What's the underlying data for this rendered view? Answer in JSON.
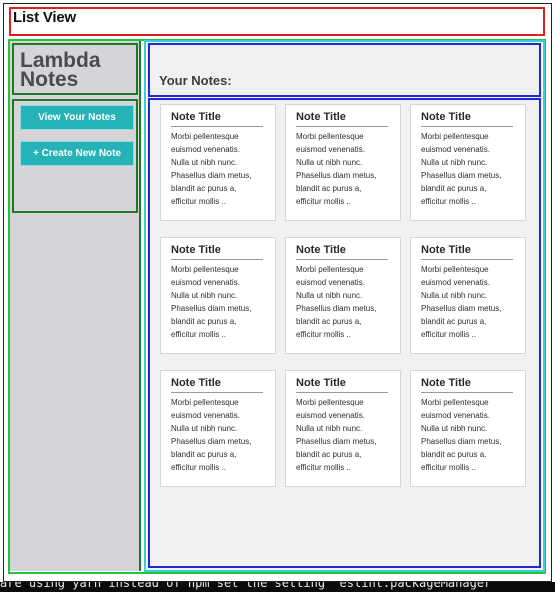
{
  "header": {
    "title": "List View"
  },
  "sidebar": {
    "logo": "Lambda\nNotes",
    "buttons": {
      "view": "View Your Notes",
      "create": "+ Create New Note"
    }
  },
  "main": {
    "heading": "Your Notes:",
    "notes": [
      {
        "title": "Note Title",
        "body": "Morbi pellentesque\neuismod venenatis.\nNulla ut nibh nunc.\nPhasellus diam metus,\nblandit ac purus a,\nefficitur mollis .."
      },
      {
        "title": "Note Title",
        "body": "Morbi pellentesque\neuismod venenatis.\nNulla ut nibh nunc.\nPhasellus diam metus,\nblandit ac purus a,\nefficitur mollis .."
      },
      {
        "title": "Note Title",
        "body": "Morbi pellentesque\neuismod venenatis.\nNulla ut nibh nunc.\nPhasellus diam metus,\nblandit ac purus a,\nefficitur mollis .."
      },
      {
        "title": "Note Title",
        "body": "Morbi pellentesque\neuismod venenatis.\nNulla ut nibh nunc.\nPhasellus diam metus,\nblandit ac purus a,\nefficitur mollis .."
      },
      {
        "title": "Note Title",
        "body": "Morbi pellentesque\neuismod venenatis.\nNulla ut nibh nunc.\nPhasellus diam metus,\nblandit ac purus a,\nefficitur mollis .."
      },
      {
        "title": "Note Title",
        "body": "Morbi pellentesque\neuismod venenatis.\nNulla ut nibh nunc.\nPhasellus diam metus,\nblandit ac purus a,\nefficitur mollis .."
      },
      {
        "title": "Note Title",
        "body": "Morbi pellentesque\neuismod venenatis.\nNulla ut nibh nunc.\nPhasellus diam metus,\nblandit ac purus a,\nefficitur mollis .."
      },
      {
        "title": "Note Title",
        "body": "Morbi pellentesque\neuismod venenatis.\nNulla ut nibh nunc.\nPhasellus diam metus,\nblandit ac purus a,\nefficitur mollis .."
      },
      {
        "title": "Note Title",
        "body": "Morbi pellentesque\neuismod venenatis.\nNulla ut nibh nunc.\nPhasellus diam metus,\nblandit ac purus a,\nefficitur mollis .."
      }
    ]
  },
  "terminal": {
    "text": "are using yarn instead of npm set the setting \"eslint.packageManager\""
  },
  "colors": {
    "header_outline": "#e02020",
    "section_outline_green": "#1f7a25",
    "section_outline_blue": "#1e2ad6",
    "main_outline_cyan": "#36d0d6",
    "button_teal": "#25b3b8",
    "sidebar_bg": "#d6d4d8",
    "main_bg": "#f1f0f3"
  }
}
